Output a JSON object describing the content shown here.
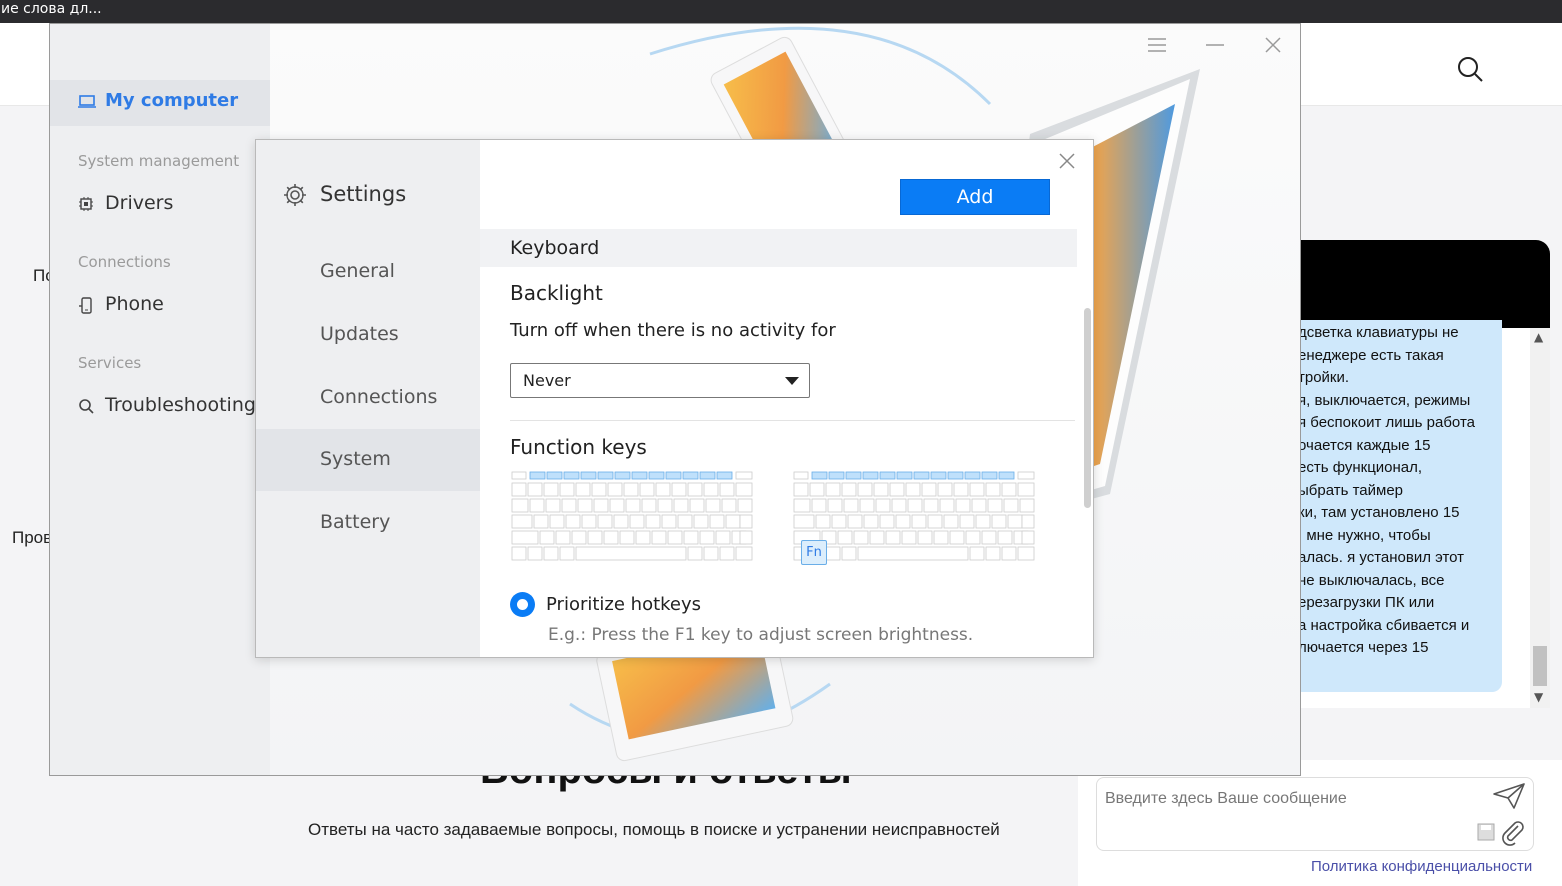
{
  "browser": {
    "tab_text": "ие слова дл..."
  },
  "background": {
    "left_fragment_1": "По",
    "left_fragment_2": "Пров",
    "heading": "Вопросы и ответы",
    "subtitle": "Ответы на часто задаваемые вопросы, помощь в поиске и устранении неисправностей"
  },
  "chat": {
    "message_lines": [
      "дсветка клавиатуры не",
      "енеджере есть такая",
      "тройки.",
      "я, выключается, режимы",
      "я беспокоит лишь работа",
      "очается каждые 15",
      "есть функционал,",
      "ыбрать таймер",
      "ки, там установлено 15",
      ". мне нужно, чтобы",
      "алась. я установил этот",
      "не выключалась, все",
      "ерезагрузки ПК или",
      "а настройка сбивается и",
      "лючается через 15"
    ],
    "input_placeholder": "Введите здесь Ваше сообщение",
    "privacy_link": "Политика конфиденциальности"
  },
  "app": {
    "sidebar": {
      "active_item": "My computer",
      "sections": [
        {
          "title": "System management",
          "item": "Drivers",
          "icon": "chip-icon"
        },
        {
          "title": "Connections",
          "item": "Phone",
          "icon": "phone-icon"
        },
        {
          "title": "Services",
          "item": "Troubleshooting",
          "icon": "search-icon"
        }
      ]
    }
  },
  "settings": {
    "title": "Settings",
    "tabs": [
      "General",
      "Updates",
      "Connections",
      "System",
      "Battery"
    ],
    "active_tab": "System",
    "add_button": "Add",
    "section": "Keyboard",
    "backlight": {
      "title": "Backlight",
      "description": "Turn off when there is no activity for",
      "selected_value": "Never"
    },
    "function_keys": {
      "title": "Function keys",
      "fn_label": "Fn",
      "option_label": "Prioritize hotkeys",
      "option_selected": true,
      "hint": "E.g.: Press the F1 key to adjust screen brightness."
    }
  },
  "colors": {
    "accent": "#0a7cf5",
    "active_nav_text": "#2f7be5",
    "sidebar_bg": "#eeeff1",
    "key_highlight": "#bfe0fb"
  }
}
